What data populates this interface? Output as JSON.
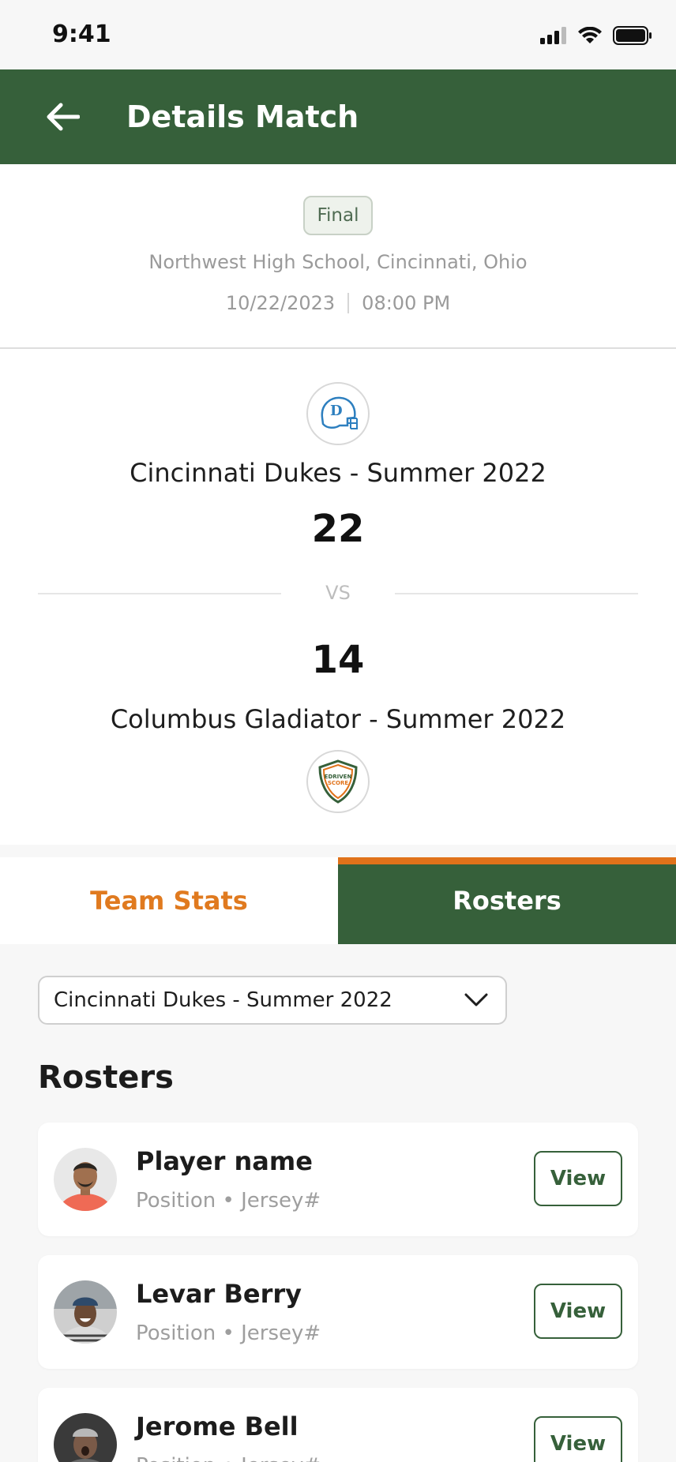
{
  "status_bar": {
    "time": "9:41"
  },
  "header": {
    "title": "Details Match"
  },
  "match": {
    "status": "Final",
    "venue": "Northwest High School, Cincinnati, Ohio",
    "date": "10/22/2023",
    "time": "08:00 PM",
    "vs_label": "VS",
    "home_team": {
      "name": "Cincinnati Dukes - Summer 2022",
      "score": "22"
    },
    "away_team": {
      "name": "Columbus Gladiator - Summer 2022",
      "score": "14",
      "logo_text_top": "EDRIVEN",
      "logo_text_bottom": "SCORE"
    }
  },
  "tabs": [
    {
      "label": "Team Stats",
      "active": false
    },
    {
      "label": "Rosters",
      "active": true
    }
  ],
  "team_select": {
    "value": "Cincinnati Dukes - Summer 2022"
  },
  "rosters": {
    "title": "Rosters",
    "view_label": "View",
    "players": [
      {
        "name": "Player name",
        "meta": "Position • Jersey#"
      },
      {
        "name": "Levar Berry",
        "meta": "Position • Jersey#"
      },
      {
        "name": "Jerome Bell",
        "meta": "Position • Jersey#"
      }
    ]
  },
  "colors": {
    "primary_green": "#36603a",
    "accent_orange": "#e0721a",
    "tab_inactive_text": "#e07a1f"
  }
}
